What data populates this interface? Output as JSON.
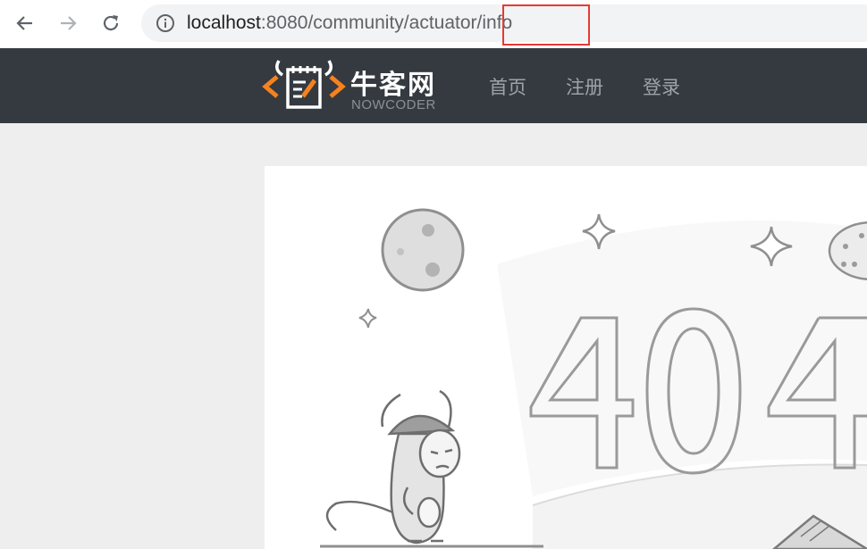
{
  "browser": {
    "back_icon": "arrow-left-icon",
    "forward_icon": "arrow-right-icon",
    "reload_icon": "reload-icon",
    "info_icon": "info-icon",
    "url_host": "localhost",
    "url_path": ":8080/community/actuator/info",
    "highlight_color": "#e53935"
  },
  "site": {
    "logo_text": "牛客网",
    "logo_subtext": "NOWCODER",
    "logo_accent": "#f5821f",
    "header_bg": "#343a40",
    "nav": [
      {
        "label": "首页"
      },
      {
        "label": "注册"
      },
      {
        "label": "登录"
      }
    ]
  },
  "error_page": {
    "code": "404"
  }
}
